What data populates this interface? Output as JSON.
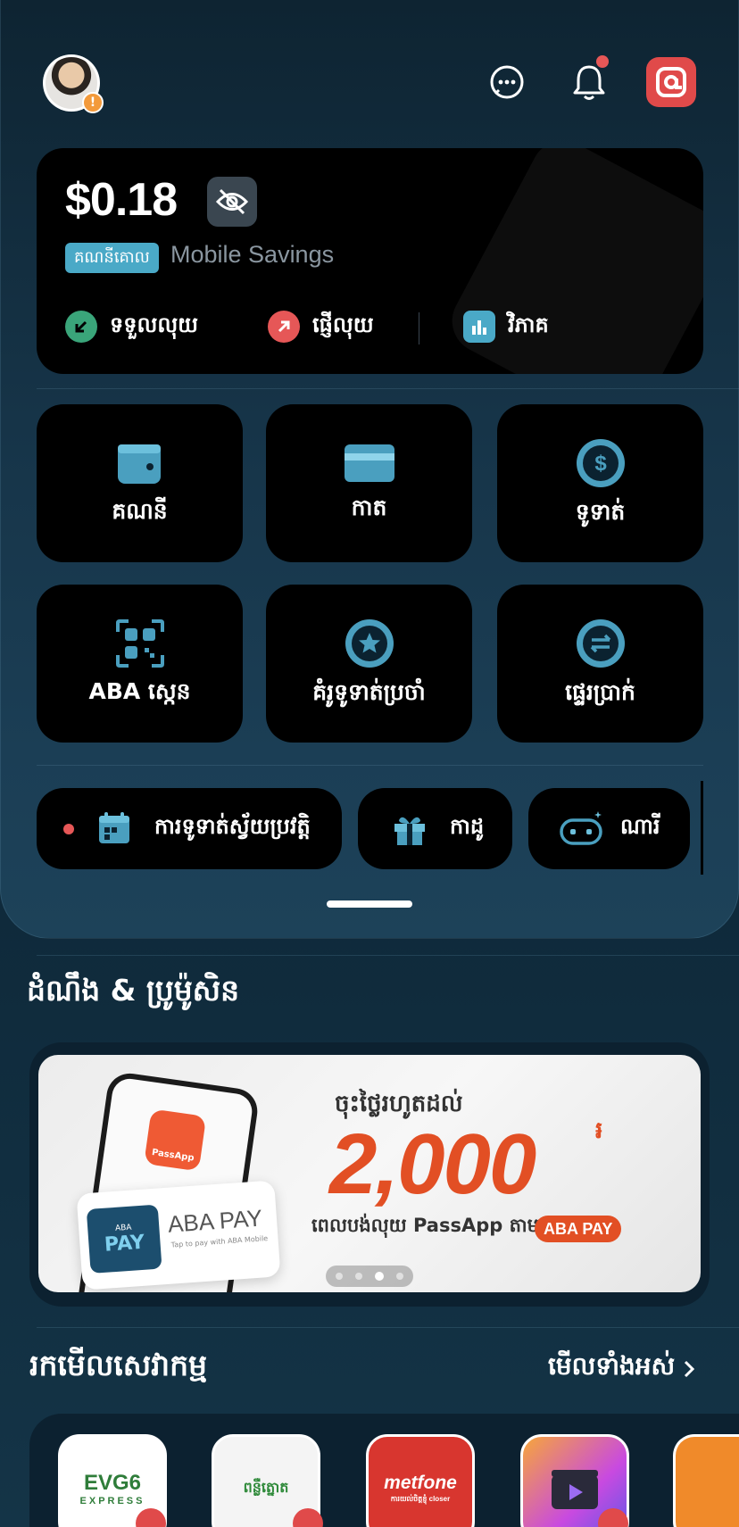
{
  "header": {
    "avatar_alert": "!"
  },
  "balance": {
    "amount": "$0.18",
    "account_badge": "គណនីគោល",
    "account_name": "Mobile Savings",
    "actions": [
      {
        "label": "ទទួលលុយ",
        "icon": "arrow-down-left-icon",
        "color": "#3aa57a"
      },
      {
        "label": "ផ្ញើលុយ",
        "icon": "arrow-up-right-icon",
        "color": "#e65757"
      },
      {
        "label": "វិភាគ",
        "icon": "bar-chart-icon",
        "color": "#4aa9c7"
      }
    ]
  },
  "tiles": [
    {
      "label": "គណនី",
      "icon": "wallet-icon"
    },
    {
      "label": "កាត",
      "icon": "card-icon"
    },
    {
      "label": "ទូទាត់",
      "icon": "dollar-coin-icon"
    },
    {
      "label": "ABA ស្កេន",
      "icon": "qr-scan-icon"
    },
    {
      "label": "គំរូទូទាត់ប្រចាំ",
      "icon": "star-coin-icon"
    },
    {
      "label": "ផ្ទេរប្រាក់",
      "icon": "transfer-icon"
    }
  ],
  "pills": [
    {
      "label": "ការទូទាត់ស្វ័យប្រវត្តិ",
      "icon": "calendar-icon"
    },
    {
      "label": "កាដូ",
      "icon": "gift-icon"
    },
    {
      "label": "ណារី",
      "icon": "robot-icon"
    }
  ],
  "news": {
    "title": "ដំណឹង & ប្រូម៉ូសិន",
    "banner": {
      "app_name": "PassApp",
      "abapay_title": "ABA PAY",
      "abapay_logo_top": "ABA",
      "abapay_logo_main": "PAY",
      "abapay_sub": "Tap to pay with ABA Mobile",
      "promo_top": "ចុះថ្លៃរហូតដល់",
      "promo_amount": "2,000",
      "promo_currency": "៛",
      "promo_bottom": "ពេលបង់លុយ PassApp តាម",
      "promo_badge": "ABA PAY",
      "pages": 4,
      "active_page": 3
    }
  },
  "services": {
    "title": "រកមើលសេវាកម្ម",
    "see_all": "មើលទាំងអស់",
    "items": [
      {
        "label": "EVG6",
        "sub": "EXPRESS"
      },
      {
        "label": "ពន្លឺត្នោត",
        "sub": ""
      },
      {
        "label": "metfone",
        "sub": "ការយល់ចិត្តខ្ញុំ closer"
      },
      {
        "label": "",
        "sub": ""
      }
    ]
  },
  "colors": {
    "accent": "#4aa9c7",
    "brand": "#e04a4a",
    "promo": "#e24f24"
  }
}
